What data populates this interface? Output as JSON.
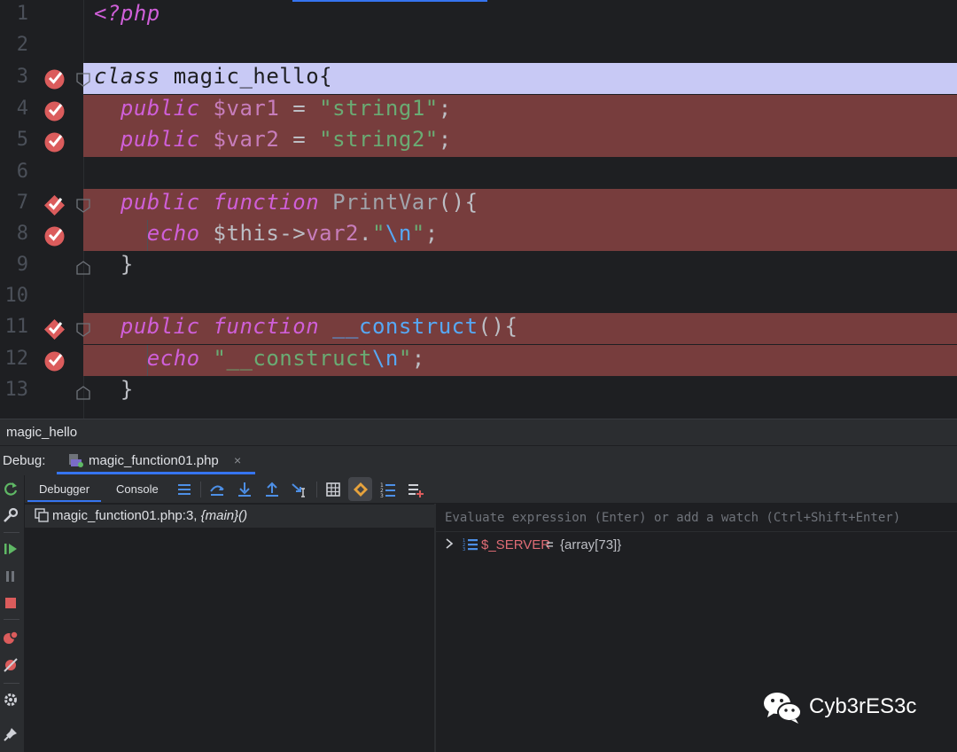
{
  "editor": {
    "lines": [
      {
        "num": "1"
      },
      {
        "num": "2"
      },
      {
        "num": "3"
      },
      {
        "num": "4"
      },
      {
        "num": "5"
      },
      {
        "num": "6"
      },
      {
        "num": "7"
      },
      {
        "num": "8"
      },
      {
        "num": "9"
      },
      {
        "num": "10"
      },
      {
        "num": "11"
      },
      {
        "num": "12"
      },
      {
        "num": "13"
      }
    ],
    "code": {
      "l1": "<?php",
      "l3_kw": "class",
      "l3_name": " magic_hello{",
      "l4_kw": "public",
      "l4_var": " $var1",
      "l4_eq": " = ",
      "l4_str": "\"string1\"",
      "l4_end": ";",
      "l5_kw": "public",
      "l5_var": " $var2",
      "l5_eq": " = ",
      "l5_str": "\"string2\"",
      "l5_end": ";",
      "l7_kw1": "public",
      "l7_kw2": " function",
      "l7_fn": " PrintVar",
      "l7_end": "(){",
      "l8_kw": "echo",
      "l8_this": " $this->",
      "l8_prop": "var2",
      "l8_dot": ".",
      "l8_q1": "\"",
      "l8_esc": "\\n",
      "l8_q2": "\"",
      "l8_end": ";",
      "l9": "}",
      "l11_kw1": "public",
      "l11_kw2": " function",
      "l11_fn": " __construct",
      "l11_end": "(){",
      "l12_kw": "echo",
      "l12_str": " \"__construct",
      "l12_esc": "\\n",
      "l12_q": "\"",
      "l12_end": ";",
      "l13": "}"
    }
  },
  "breadcrumb": {
    "text": "magic_hello"
  },
  "debug": {
    "label": "Debug:",
    "session_tab": "magic_function01.php",
    "close_glyph": "×"
  },
  "toolbar": {
    "tab_debugger": "Debugger",
    "tab_console": "Console"
  },
  "frames": {
    "items": [
      {
        "location": "magic_function01.php:3, ",
        "function": "{main}()"
      }
    ]
  },
  "variables": {
    "eval_placeholder": "Evaluate expression (Enter) or add a watch (Ctrl+Shift+Enter)",
    "items": [
      {
        "name": "$_SERVER",
        "eq": "=",
        "value": "{array[73]}"
      }
    ]
  },
  "watermark": {
    "text": "Cyb3rES3c"
  },
  "colors": {
    "breakpoint_line": "#773d3d",
    "execution_line": "#c8c9f5",
    "accent": "#3574f0",
    "keyword": "#cf5fd8",
    "string": "#6aab73"
  }
}
